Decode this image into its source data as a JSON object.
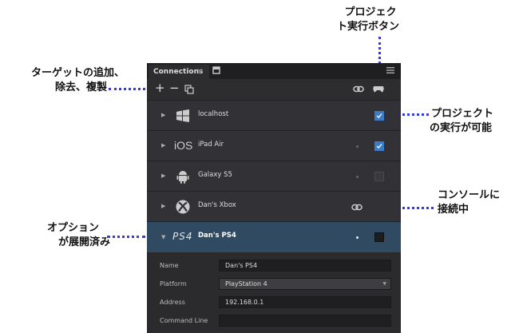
{
  "callouts": {
    "run_button_l1": "プロジェク",
    "run_button_l2": "ト実行ボタン",
    "target_ops_l1": "ターゲットの追加、",
    "target_ops_l2": "除去、複製",
    "can_run_l1": "プロジェクト",
    "can_run_l2": "の実行が可能",
    "connected_l1": "コンソールに",
    "connected_l2": "接続中",
    "options_l1": "オプション",
    "options_l2": "が展開済み"
  },
  "panel": {
    "tab_title": "Connections",
    "tab_close": "✕",
    "toolbar": {
      "add": "+",
      "remove": "−"
    },
    "targets": [
      {
        "label": "localhost",
        "icon": "windows-icon",
        "checked": true,
        "connected": false
      },
      {
        "label": "iPad Air",
        "icon_text": "iOS",
        "icon": "ios-icon",
        "checked": true,
        "connected": false
      },
      {
        "label": "Galaxy S5",
        "icon": "android-icon",
        "checked": false,
        "connected": false
      },
      {
        "label": "Dan's Xbox",
        "icon": "xbox-icon",
        "checked": null,
        "connected": true
      },
      {
        "label": "Dan's PS4",
        "icon_text": "PS4",
        "icon": "ps4-icon",
        "checked": false,
        "connected": false,
        "expanded": true
      }
    ],
    "properties": {
      "name_label": "Name",
      "name_value": "Dan's PS4",
      "platform_label": "Platform",
      "platform_value": "PlayStation 4",
      "address_label": "Address",
      "address_value": "192.168.0.1",
      "command_label": "Command Line",
      "command_value": ""
    }
  },
  "colors": {
    "accent": "#3a3ad6",
    "selected_row": "#2f4a61",
    "checkbox_on": "#3c7cc7"
  }
}
